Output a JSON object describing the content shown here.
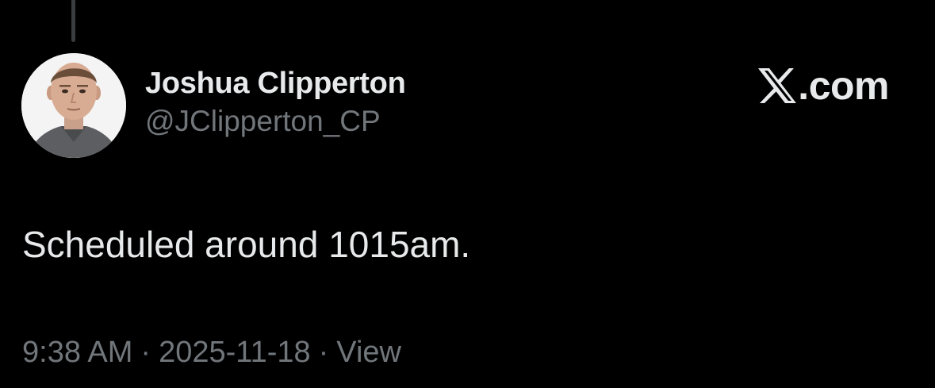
{
  "post": {
    "author": {
      "display_name": "Joshua Clipperton",
      "handle": "@JClipperton_CP",
      "avatar": "profile-photo"
    },
    "brand": {
      "icon": "x-logo-icon",
      "text": ".com"
    },
    "text": "Scheduled around 1015am.",
    "meta": {
      "time": "9:38 AM",
      "separator": "·",
      "date": "2025-11-18",
      "views_label": "View"
    }
  },
  "colors": {
    "background": "#000000",
    "primary_text": "#e7e9ea",
    "secondary_text": "#71767b",
    "thread_line": "#3a3d40"
  }
}
